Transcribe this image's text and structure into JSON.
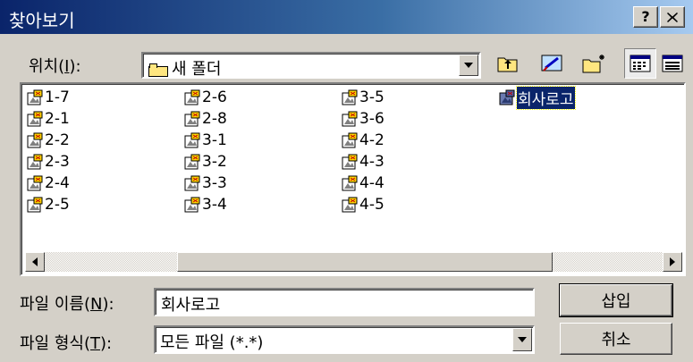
{
  "window": {
    "title": "찾아보기",
    "help_label": "?",
    "close_label": "X"
  },
  "location": {
    "label_prefix": "위치(",
    "label_key": "I",
    "label_suffix": "):",
    "value": "새 폴더"
  },
  "toolbar": {
    "items": [
      "up-folder-icon",
      "desktop-icon",
      "new-folder-icon",
      "list-view-icon",
      "details-view-icon"
    ]
  },
  "files": [
    {
      "name": "1-7"
    },
    {
      "name": "2-1"
    },
    {
      "name": "2-2"
    },
    {
      "name": "2-3"
    },
    {
      "name": "2-4"
    },
    {
      "name": "2-5"
    },
    {
      "name": "2-6"
    },
    {
      "name": "2-8"
    },
    {
      "name": "3-1"
    },
    {
      "name": "3-2"
    },
    {
      "name": "3-3"
    },
    {
      "name": "3-4"
    },
    {
      "name": "3-5"
    },
    {
      "name": "3-6"
    },
    {
      "name": "4-2"
    },
    {
      "name": "4-3"
    },
    {
      "name": "4-4"
    },
    {
      "name": "4-5"
    },
    {
      "name": "회사로고",
      "selected": true
    }
  ],
  "filename": {
    "label_prefix": "파일 이름(",
    "label_key": "N",
    "label_suffix": "):",
    "value": "회사로고"
  },
  "filetype": {
    "label_prefix": "파일 형식(",
    "label_key": "T",
    "label_suffix": "):",
    "value": "모든 파일 (*.*)"
  },
  "buttons": {
    "insert": "삽입",
    "cancel": "취소"
  },
  "colors": {
    "title_start": "#0a246a",
    "title_end": "#a6caf0",
    "face": "#d4d0c8",
    "selection": "#0a246a"
  }
}
